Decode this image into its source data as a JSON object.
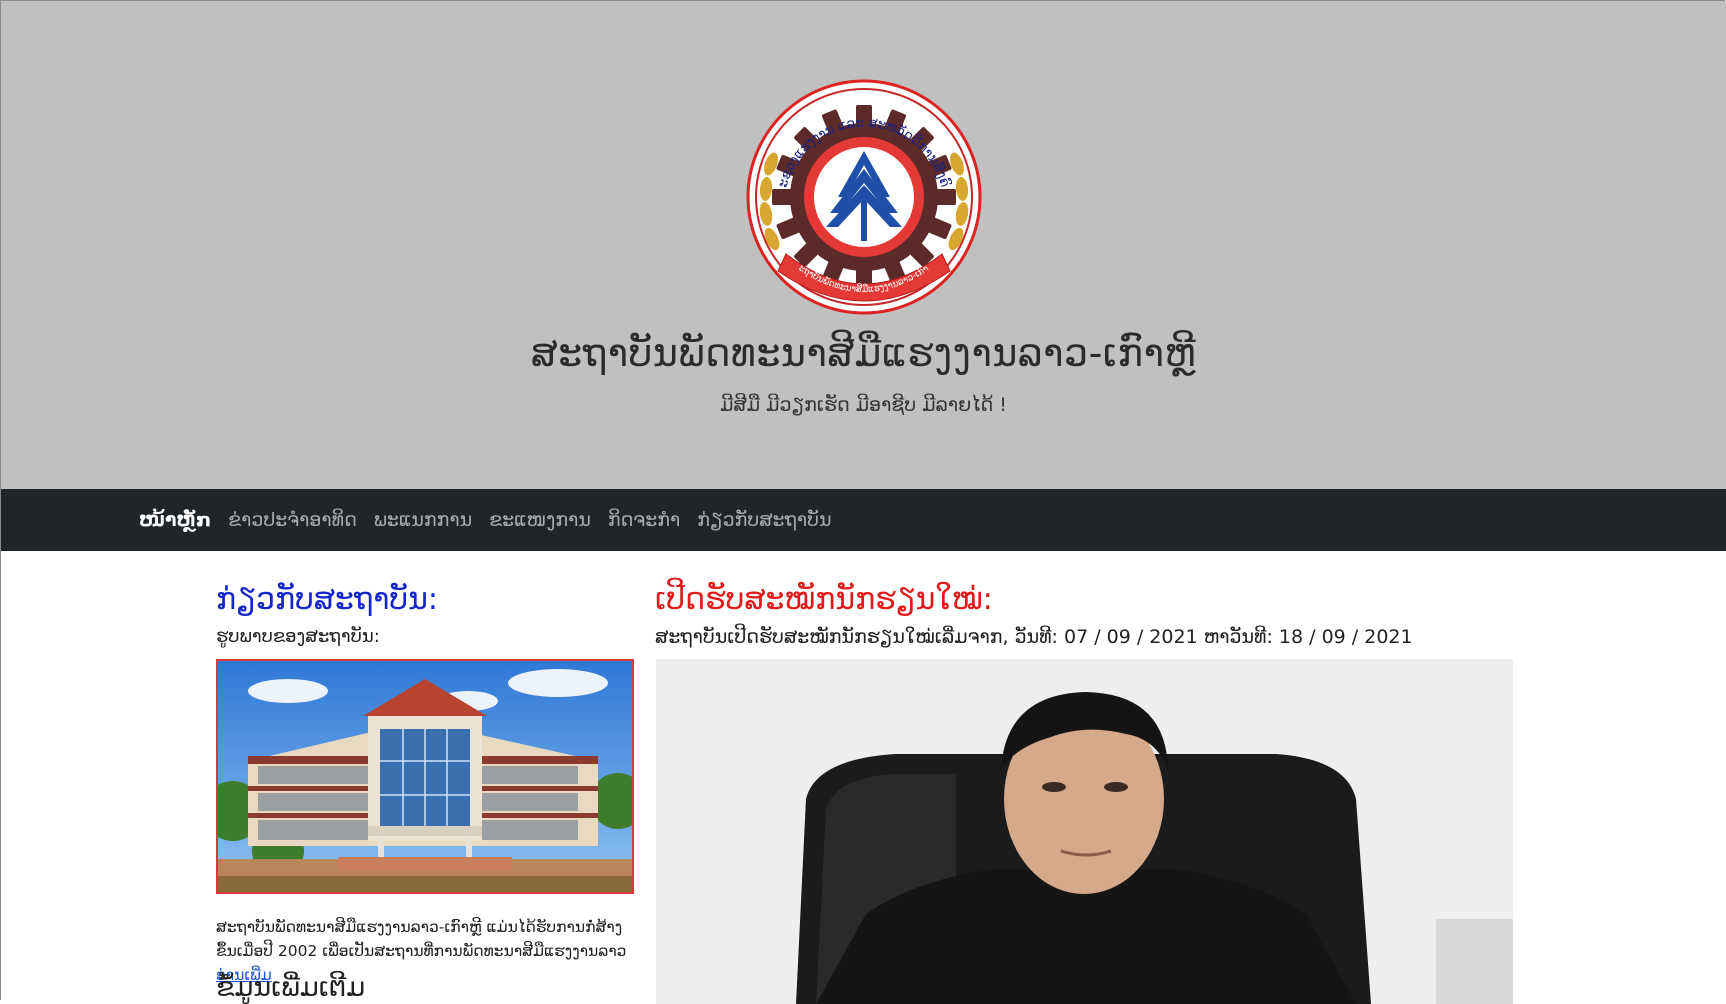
{
  "header": {
    "site_title": "ສະຖາບັນພັດທະນາສີມືແຮງງານລາວ-ເກົາຫຼີ",
    "tagline": "ມີສີມື ມີວຽກເຮັດ ມີອາຊີບ ມີລາຍໄດ້ !",
    "logo": {
      "icon": "institute-seal-logo",
      "top_arc_text": "ກະຊວງແຮງງານ ແລະ ສະຫວັດດີການສັງຄົມ",
      "ribbon_text": "ສະຖາບັນພັດທະນາສີມືແຮງງານລາວ-ເກົາຫຼີ"
    }
  },
  "nav": {
    "items": [
      {
        "label": "ໜ້າຫຼັກ",
        "active": true
      },
      {
        "label": "ຂ່າວປະຈຳອາທິດ",
        "active": false
      },
      {
        "label": "ພະແນກການ",
        "active": false
      },
      {
        "label": "ຂະແໜງການ",
        "active": false
      },
      {
        "label": "ກິດຈະກຳ",
        "active": false
      },
      {
        "label": "ກ່ຽວກັບສະຖາບັນ",
        "active": false
      }
    ]
  },
  "left": {
    "heading": "ກ່ຽວກັບສະຖາບັນ:",
    "subheading": "ຮູບພາບຂອງສະຖາບັນ:",
    "image_icon": "institute-building-photo",
    "description": "ສະຖາບັນພັດທະນາສີມືແຮງງານລາວ-ເກົາຫຼີ ແມ່ນໄດ້ຮັບການກໍ່ສ້າງຂຶ້ນເມື່ອປີ 2002 ເພື່ອເປັນສະຖານທີ່ການພັດທະນາສີມືແຮງງານລາວ",
    "read_more": "ອ່ານເພີ່ມ",
    "more_heading": "ຂໍ້ມູນເພີ່ມເຕີມ"
  },
  "right": {
    "heading": "ເປີດຮັບສະໝັກນັກຮຽນໃໝ່:",
    "subheading": "ສະຖາບັນເປີດຮັບສະໝັກນັກຮຽນໃໝ່ເລີ່ມຈາກ, ວັນທີ: 07 / 09 / 2021 ຫາວັນທີ: 18 / 09 / 2021",
    "image_icon": "director-portrait-photo"
  },
  "colors": {
    "header_bg": "#c0c0c0",
    "navbar_bg": "#212529",
    "about_heading": "#1426c9",
    "news_heading": "#e01b1b",
    "link": "#1a55d6"
  }
}
